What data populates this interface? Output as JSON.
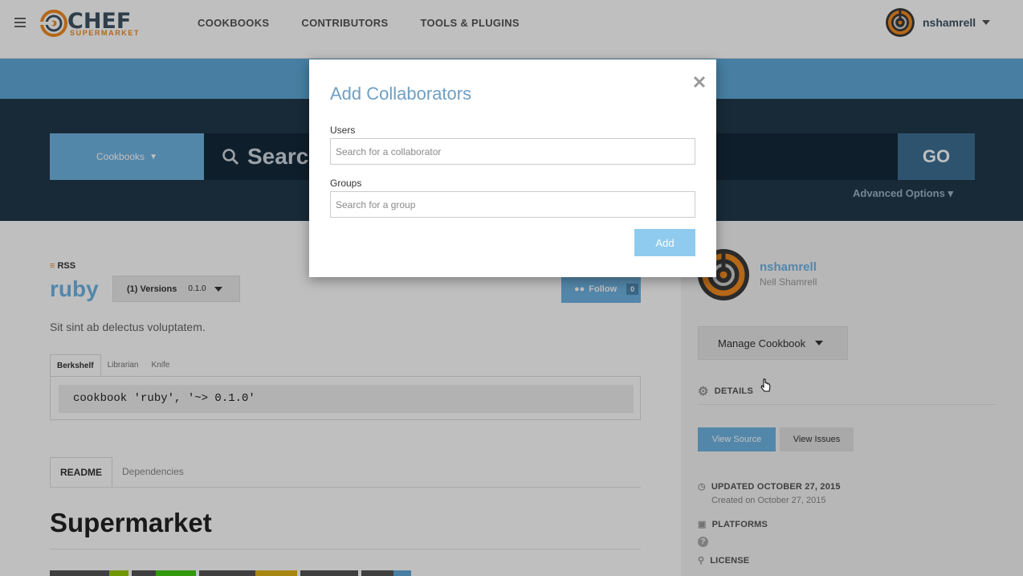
{
  "nav": {
    "logo_text": "CHEF",
    "logo_sub": "SUPERMARKET",
    "links": [
      "COOKBOOKS",
      "CONTRIBUTORS",
      "TOOLS & PLUGINS"
    ],
    "user": "nshamrell"
  },
  "search": {
    "type_label": "Cookbooks",
    "placeholder": "Search",
    "go_label": "GO",
    "advanced": "Advanced Options"
  },
  "cookbook": {
    "rss": "RSS",
    "name": "ruby",
    "versions_label": "(1) Versions",
    "version": "0.1.0",
    "follow_label": "Follow",
    "follow_count": "0",
    "description": "Sit sint ab delectus voluptatem.",
    "install_tabs": [
      "Berkshelf",
      "Librarian",
      "Knife"
    ],
    "install_code": "cookbook 'ruby', '~> 0.1.0'",
    "content_tabs": [
      "README",
      "Dependencies"
    ],
    "readme_title": "Supermarket"
  },
  "sidebar": {
    "owner_username": "nshamrell",
    "owner_fullname": "Nell Shamrell",
    "manage_label": "Manage Cookbook",
    "details_label": "DETAILS",
    "view_source": "View Source",
    "view_issues": "View Issues",
    "updated": "UPDATED OCTOBER 27, 2015",
    "created": "Created on October 27, 2015",
    "platforms": "PLATFORMS",
    "license": "LICENSE"
  },
  "modal": {
    "title": "Add Collaborators",
    "users_label": "Users",
    "users_placeholder": "Search for a collaborator",
    "groups_label": "Groups",
    "groups_placeholder": "Search for a group",
    "add_label": "Add"
  },
  "colors": {
    "accent": "#6fb5e3",
    "brand_orange": "#f18b21",
    "dark_navy": "#20394a"
  }
}
